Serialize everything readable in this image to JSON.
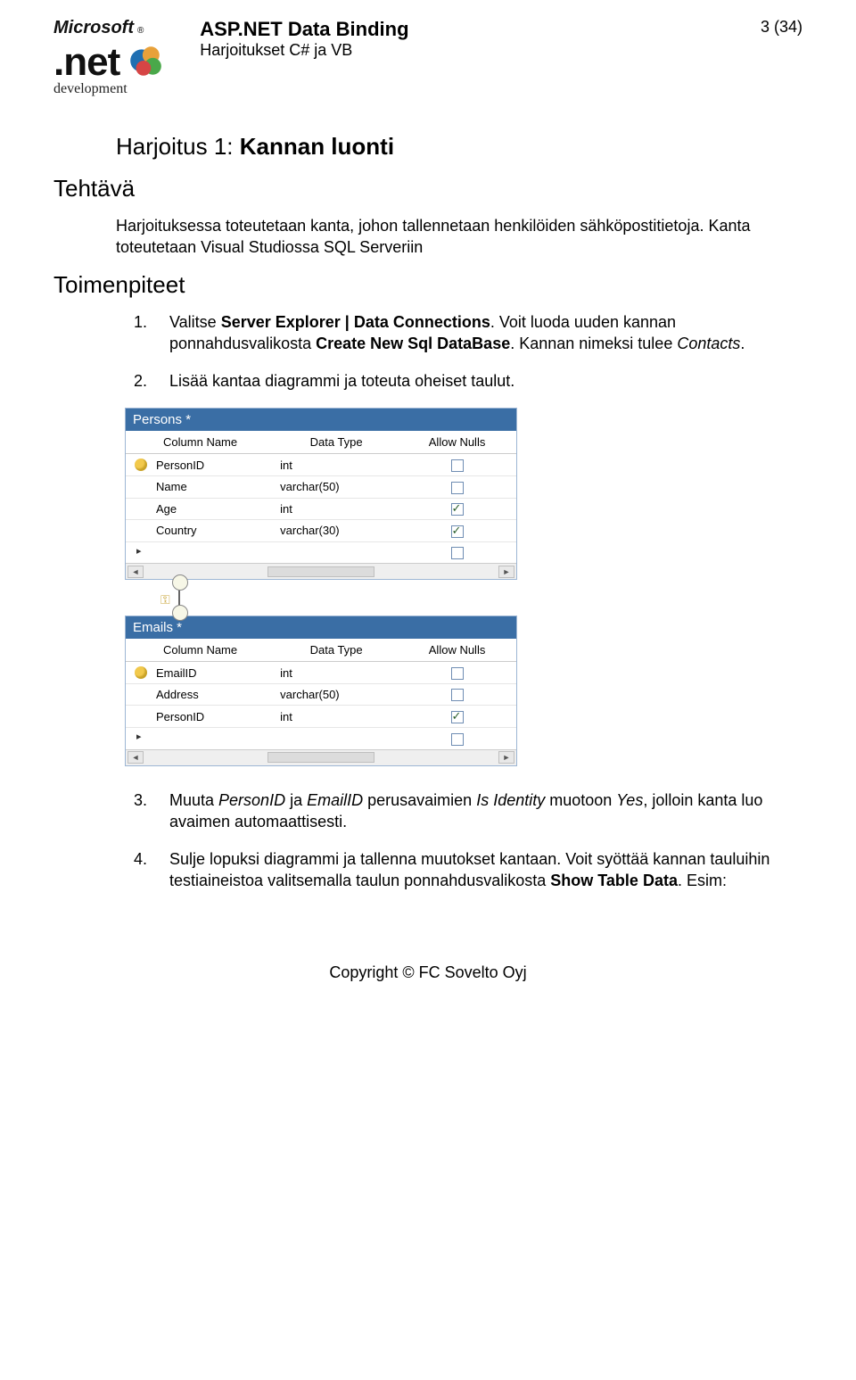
{
  "header": {
    "logo_ms": "Microsoft",
    "logo_reg": "®",
    "logo_net": ".net",
    "logo_dev": "development",
    "doc_title": "ASP.NET Data Binding",
    "doc_sub": "Harjoitukset C# ja VB",
    "page_num": "3 (34)"
  },
  "section": {
    "title_prefix": "Harjoitus 1: ",
    "title_bold": "Kannan luonti",
    "heading_task": "Tehtävä",
    "task_text_1": "Harjoituksessa toteutetaan kanta, johon tallennetaan henkilöiden sähköpostitietoja. Kanta toteutetaan Visual Studiossa SQL Serveriin",
    "heading_steps": "Toimenpiteet"
  },
  "steps": {
    "s1": {
      "num": "1.",
      "a": "Valitse ",
      "b": "Server Explorer | Data Connections",
      "c": ". Voit luoda uuden kannan ponnahdusvalikosta ",
      "d": "Create New Sql DataBase",
      "e": ". Kannan nimeksi tulee ",
      "f": "Contacts",
      "g": "."
    },
    "s2": {
      "num": "2.",
      "text": "Lisää kantaa diagrammi ja toteuta oheiset taulut."
    },
    "s3": {
      "num": "3.",
      "a": "Muuta ",
      "b": "PersonID",
      "c": " ja ",
      "d": "EmailID",
      "e": " perusavaimien ",
      "f": "Is Identity",
      "g": " muotoon ",
      "h": "Yes",
      "i": ", jolloin kanta luo avaimen automaattisesti."
    },
    "s4": {
      "num": "4.",
      "a": "Sulje lopuksi diagrammi ja tallenna muutokset kantaan. Voit syöttää kannan tauluihin testiaineistoa valitsemalla taulun ponnahdusvalikosta ",
      "b": "Show Table Data",
      "c": ". Esim:"
    }
  },
  "tables": {
    "col_name": "Column Name",
    "data_type": "Data Type",
    "allow_nulls": "Allow Nulls",
    "persons": {
      "title": "Persons *",
      "rows": [
        {
          "name": "PersonID",
          "type": "int",
          "null": false,
          "key": true
        },
        {
          "name": "Name",
          "type": "varchar(50)",
          "null": false,
          "key": false
        },
        {
          "name": "Age",
          "type": "int",
          "null": true,
          "key": false
        },
        {
          "name": "Country",
          "type": "varchar(30)",
          "null": true,
          "key": false
        }
      ]
    },
    "emails": {
      "title": "Emails *",
      "rows": [
        {
          "name": "EmailID",
          "type": "int",
          "null": false,
          "key": true
        },
        {
          "name": "Address",
          "type": "varchar(50)",
          "null": false,
          "key": false
        },
        {
          "name": "PersonID",
          "type": "int",
          "null": true,
          "key": false
        }
      ]
    }
  },
  "footer": "Copyright © FC Sovelto Oyj"
}
